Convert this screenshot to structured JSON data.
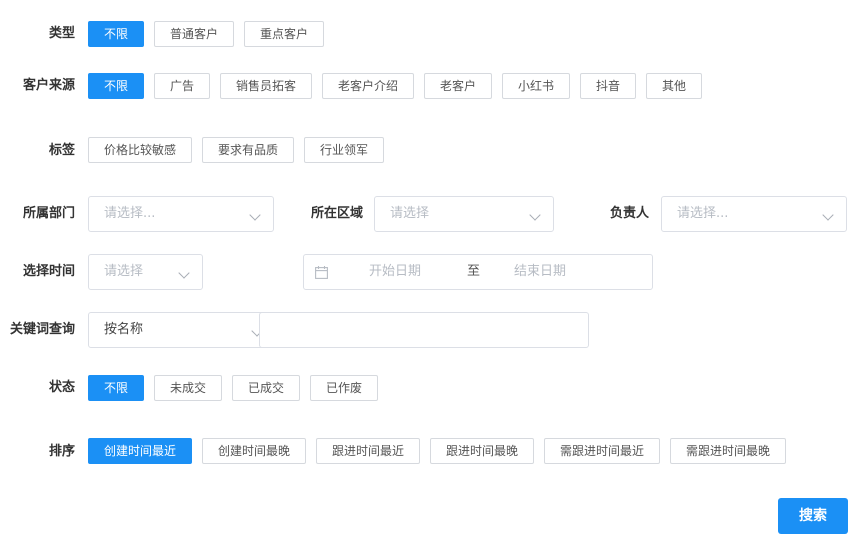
{
  "type_row": {
    "label": "类型",
    "options": [
      "不限",
      "普通客户",
      "重点客户"
    ]
  },
  "source_row": {
    "label": "客户来源",
    "options": [
      "不限",
      "广告",
      "销售员拓客",
      "老客户介绍",
      "老客户",
      "小红书",
      "抖音",
      "其他"
    ]
  },
  "tag_row": {
    "label": "标签",
    "options": [
      "价格比较敏感",
      "要求有品质",
      "行业领军"
    ]
  },
  "org_row": {
    "dept_label": "所属部门",
    "dept_placeholder": "请选择...",
    "region_label": "所在区域",
    "region_placeholder": "请选择",
    "owner_label": "负责人",
    "owner_placeholder": "请选择..."
  },
  "time_row": {
    "label": "选择时间",
    "select_placeholder": "请选择",
    "start_placeholder": "开始日期",
    "separator": "至",
    "end_placeholder": "结束日期"
  },
  "keyword_row": {
    "label": "关键词查询",
    "mode_value": "按名称",
    "input_value": ""
  },
  "status_row": {
    "label": "状态",
    "options": [
      "不限",
      "未成交",
      "已成交",
      "已作废"
    ]
  },
  "sort_row": {
    "label": "排序",
    "options": [
      "创建时间最近",
      "创建时间最晚",
      "跟进时间最近",
      "跟进时间最晚",
      "需跟进时间最近",
      "需跟进时间最晚"
    ]
  },
  "search_button": "搜索",
  "accent_color": "#1b90f5",
  "icons": [
    "chevron-down-icon",
    "calendar-icon"
  ]
}
